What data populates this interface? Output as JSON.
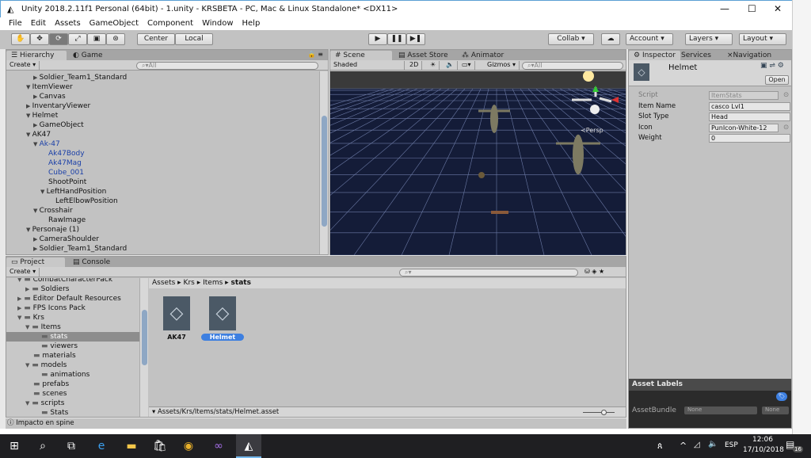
{
  "window": {
    "title": "Unity 2018.2.11f1 Personal (64bit) - 1.unity - KRSBETA - PC, Mac & Linux Standalone* <DX11>",
    "minimize": "—",
    "maximize": "☐",
    "close": "✕"
  },
  "menu": [
    "File",
    "Edit",
    "Assets",
    "GameObject",
    "Component",
    "Window",
    "Help"
  ],
  "toolbar": {
    "tools": [
      "✋",
      "✥",
      "⟳",
      "⤢",
      "▣",
      "⊛"
    ],
    "active_tool": 2,
    "pivot": "Center",
    "space": "Local",
    "play": "▶",
    "pause": "❚❚",
    "step": "▶❚",
    "collab": "Collab ▾",
    "cloud": "☁",
    "account": "Account",
    "layers": "Layers",
    "layout": "Layout"
  },
  "hierarchy": {
    "tabs": [
      "Hierarchy",
      "Game"
    ],
    "create": "Create ▾",
    "search_placeholder": "All",
    "rows": [
      {
        "label": "Soldier_Team1_Standard",
        "depth": 2,
        "arrow": "collapsed"
      },
      {
        "label": "ItemViewer",
        "depth": 1,
        "arrow": "expanded"
      },
      {
        "label": "Canvas",
        "depth": 2,
        "arrow": "collapsed"
      },
      {
        "label": "InventaryViewer",
        "depth": 1,
        "arrow": "collapsed"
      },
      {
        "label": "Helmet",
        "depth": 1,
        "arrow": "expanded"
      },
      {
        "label": "GameObject",
        "depth": 2,
        "arrow": "collapsed"
      },
      {
        "label": "AK47",
        "depth": 1,
        "arrow": "expanded"
      },
      {
        "label": "Ak-47",
        "depth": 2,
        "arrow": "expanded",
        "prefab": true
      },
      {
        "label": "Ak47Body",
        "depth": 3,
        "prefab": true
      },
      {
        "label": "Ak47Mag",
        "depth": 3,
        "prefab": true
      },
      {
        "label": "Cube_001",
        "depth": 3,
        "prefab": true
      },
      {
        "label": "ShootPoint",
        "depth": 3
      },
      {
        "label": "LeftHandPosition",
        "depth": 3,
        "arrow": "expanded"
      },
      {
        "label": "LeftElbowPosition",
        "depth": 4
      },
      {
        "label": "Crosshair",
        "depth": 2,
        "arrow": "expanded"
      },
      {
        "label": "RawImage",
        "depth": 3
      },
      {
        "label": "Personaje (1)",
        "depth": 1,
        "arrow": "expanded"
      },
      {
        "label": "CameraShoulder",
        "depth": 2,
        "arrow": "collapsed"
      },
      {
        "label": "Soldier_Team1_Standard",
        "depth": 2,
        "arrow": "collapsed"
      }
    ]
  },
  "scene": {
    "tabs": [
      "Scene",
      "Asset Store",
      "Animator"
    ],
    "shading": "Shaded",
    "mode_2d": "2D",
    "gizmos": "Gizmos ▾",
    "search_placeholder": "All",
    "persp": "≺Persp"
  },
  "inspector": {
    "tabs": [
      "Inspector",
      "Services",
      "Navigation"
    ],
    "object_name": "Helmet",
    "open": "Open",
    "fields": [
      {
        "label": "Script",
        "value": "ItemStats",
        "disabled": true
      },
      {
        "label": "Item Name",
        "value": "casco Lvl1"
      },
      {
        "label": "Slot Type",
        "value": "Head"
      },
      {
        "label": "Icon",
        "value": "PunIcon-White-12"
      },
      {
        "label": "Weight",
        "value": "0"
      }
    ],
    "asset_labels": "Asset Labels",
    "asset_bundle": "AssetBundle",
    "bundle_name": "None",
    "bundle_variant": "None"
  },
  "project": {
    "tabs": [
      "Project",
      "Console"
    ],
    "create": "Create ▾",
    "tree": [
      {
        "label": "CombatCharacterPack",
        "depth": 1,
        "arrow": "expanded"
      },
      {
        "label": "Soldiers",
        "depth": 2,
        "arrow": "collapsed"
      },
      {
        "label": "Editor Default Resources",
        "depth": 1,
        "arrow": "collapsed"
      },
      {
        "label": "FPS Icons Pack",
        "depth": 1,
        "arrow": "collapsed"
      },
      {
        "label": "Krs",
        "depth": 1,
        "arrow": "expanded"
      },
      {
        "label": "Items",
        "depth": 2,
        "arrow": "expanded"
      },
      {
        "label": "stats",
        "depth": 3,
        "selected": true
      },
      {
        "label": "viewers",
        "depth": 3
      },
      {
        "label": "materials",
        "depth": 2
      },
      {
        "label": "models",
        "depth": 2,
        "arrow": "expanded"
      },
      {
        "label": "animations",
        "depth": 3
      },
      {
        "label": "prefabs",
        "depth": 2
      },
      {
        "label": "scenes",
        "depth": 2
      },
      {
        "label": "scripts",
        "depth": 2,
        "arrow": "expanded"
      },
      {
        "label": "Stats",
        "depth": 3
      }
    ],
    "breadcrumb": [
      "Assets",
      "Krs",
      "Items",
      "stats"
    ],
    "assets": [
      {
        "label": "AK47"
      },
      {
        "label": "Helmet",
        "selected": true
      }
    ],
    "footer_path": "Assets/Krs/Items/stats/Helmet.asset"
  },
  "status": "Impacto en spine",
  "taskbar": {
    "lang": "ESP",
    "time": "12:06",
    "date": "17/10/2018",
    "notifications": "16"
  },
  "colors": {
    "selection": "#3d7fe0",
    "prefab_text": "#1a3fa8",
    "scene_bg": "#141c38"
  }
}
